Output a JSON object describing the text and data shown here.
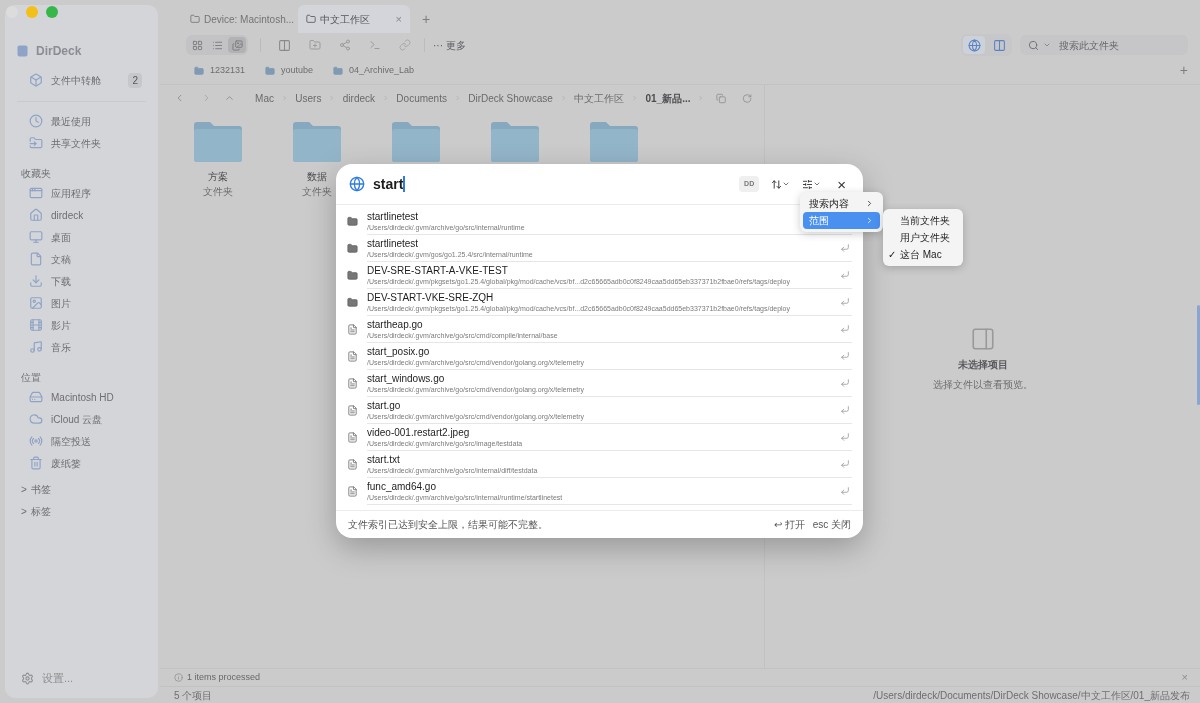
{
  "window": {
    "tabs": [
      {
        "label": "Device: Macintosh...",
        "selected": false
      },
      {
        "label": "中文工作区",
        "selected": true,
        "close": "×"
      }
    ],
    "new_tab": "+"
  },
  "toolbar": {
    "views": [
      {
        "selected": false
      },
      {
        "selected": false
      },
      {
        "selected": true
      }
    ],
    "more": "··· 更多",
    "global_search_on": true,
    "search": {
      "placeholder": "搜索此文件夹"
    }
  },
  "favorites_bar": {
    "items": [
      "1232131",
      "youtube",
      "04_Archive_Lab"
    ],
    "add": "+"
  },
  "breadcrumb": [
    "Mac",
    "Users",
    "dirdeck",
    "Documents",
    "DirDeck Showcase",
    "中文工作区",
    "01_新品..."
  ],
  "sidebar": {
    "app_name": "DirDeck",
    "transfer": {
      "label": "文件中转舱",
      "badge": "2"
    },
    "top_items": [
      "最近使用",
      "共享文件夹"
    ],
    "sections": [
      {
        "title": "收藏夹",
        "items": [
          "应用程序",
          "dirdeck",
          "桌面",
          "文稿",
          "下载",
          "图片",
          "影片",
          "音乐"
        ]
      },
      {
        "title": "位置",
        "items": [
          "Macintosh HD",
          "iCloud 云盘",
          "隔空投送",
          "废纸篓"
        ]
      }
    ],
    "groups": [
      {
        "chevron": ">",
        "label": "书签",
        "expanded": false
      },
      {
        "chevron": ">",
        "label": "标签",
        "expanded": false
      }
    ],
    "settings": "设置..."
  },
  "folders": [
    {
      "kind": "folder",
      "name": "方案",
      "type": "文件夹"
    },
    {
      "kind": "folder",
      "name": "数据",
      "type": "文件夹"
    },
    {
      "kind": "folder"
    },
    {
      "kind": "folder"
    },
    {
      "kind": "folder"
    }
  ],
  "preview": {
    "title": "未选择项目",
    "hint": "选择文件以查看预览。"
  },
  "status_bar": {
    "message": "1 items processed",
    "close": "×",
    "count": "5 个项目",
    "path": "/Users/dirdeck/Documents/DirDeck Showcase/中文工作区/01_新品发布"
  },
  "search_dialog": {
    "query": "start",
    "chip": "DD",
    "close": "×",
    "results": [
      {
        "kind": "folder",
        "name": "startlinetest",
        "path": "/Users/dirdeck/.gvm/archive/go/src/internal/runtime",
        "enter_hint": false
      },
      {
        "kind": "folder",
        "name": "startlinetest",
        "path": "/Users/dirdeck/.gvm/gos/go1.25.4/src/internal/runtime",
        "enter_hint": true
      },
      {
        "kind": "folder",
        "name": "DEV-SRE-START-A-VKE-TEST",
        "path": "/Users/dirdeck/.gvm/pkgsets/go1.25.4/global/pkg/mod/cache/vcs/bf...d2c65665adb0c0f8249caa5dd65eb337371b2fbae0/refs/tags/deploy",
        "enter_hint": true
      },
      {
        "kind": "folder",
        "name": "DEV-START-VKE-SRE-ZQH",
        "path": "/Users/dirdeck/.gvm/pkgsets/go1.25.4/global/pkg/mod/cache/vcs/bf...d2c65665adb0c0f8249caa5dd65eb337371b2fbae0/refs/tags/deploy",
        "enter_hint": true
      },
      {
        "kind": "file",
        "name": "startheap.go",
        "path": "/Users/dirdeck/.gvm/archive/go/src/cmd/compile/internal/base",
        "enter_hint": true
      },
      {
        "kind": "file",
        "name": "start_posix.go",
        "path": "/Users/dirdeck/.gvm/archive/go/src/cmd/vendor/golang.org/x/telemetry",
        "enter_hint": true
      },
      {
        "kind": "file",
        "name": "start_windows.go",
        "path": "/Users/dirdeck/.gvm/archive/go/src/cmd/vendor/golang.org/x/telemetry",
        "enter_hint": true
      },
      {
        "kind": "file",
        "name": "start.go",
        "path": "/Users/dirdeck/.gvm/archive/go/src/cmd/vendor/golang.org/x/telemetry",
        "enter_hint": true
      },
      {
        "kind": "file",
        "name": "video-001.restart2.jpeg",
        "path": "/Users/dirdeck/.gvm/archive/go/src/image/testdata",
        "enter_hint": true
      },
      {
        "kind": "file",
        "name": "start.txt",
        "path": "/Users/dirdeck/.gvm/archive/go/src/internal/diff/testdata",
        "enter_hint": true
      },
      {
        "kind": "file",
        "name": "func_amd64.go",
        "path": "/Users/dirdeck/.gvm/archive/go/src/internal/runtime/startlinetest",
        "enter_hint": true
      }
    ],
    "footer_note": "文件索引已达到安全上限，结果可能不完整。",
    "open_hint": "↩ 打开",
    "close_hint": "esc 关闭",
    "menu": {
      "items": [
        {
          "label": "搜索内容",
          "selected": false
        },
        {
          "label": "范围",
          "selected": true
        }
      ],
      "check": "✓",
      "submenu": [
        {
          "label": "当前文件夹",
          "checked": false
        },
        {
          "label": "用户文件夹",
          "checked": false
        },
        {
          "label": "这台 Mac",
          "checked": true
        }
      ]
    }
  }
}
